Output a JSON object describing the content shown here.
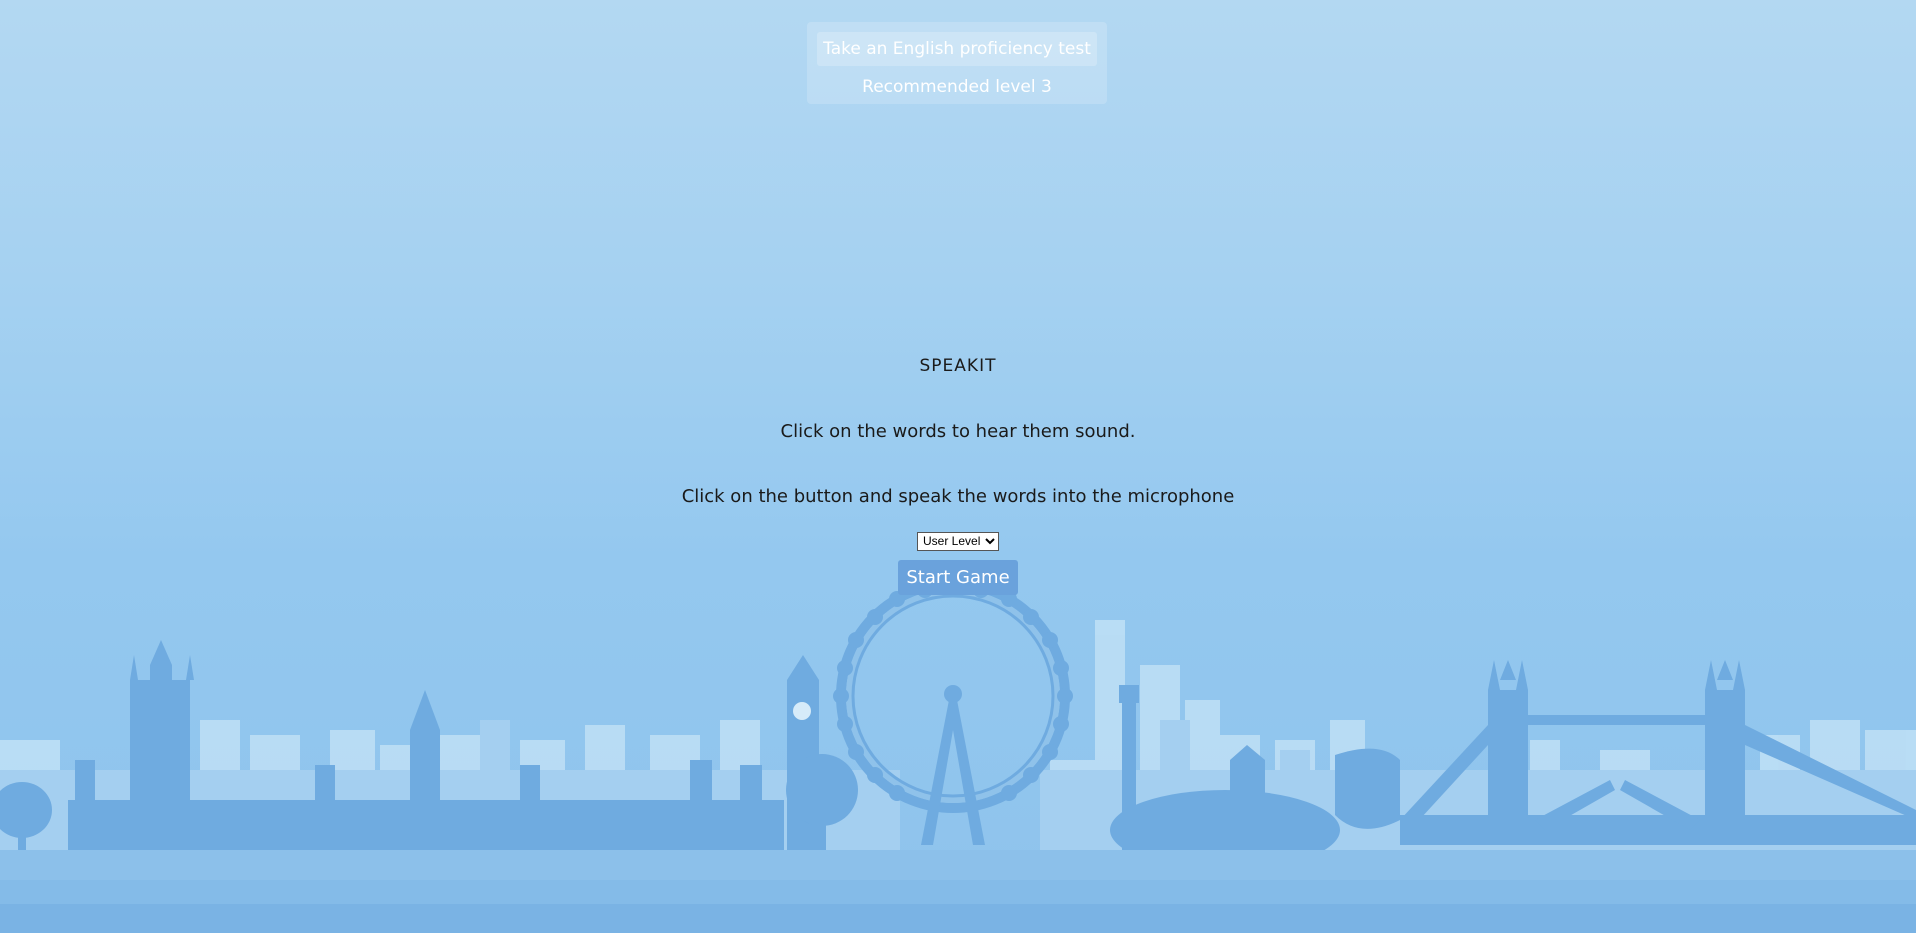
{
  "proficiency": {
    "link_label": "Take an English proficiency test",
    "recommended": "Recommended level 3"
  },
  "main": {
    "title": "SPEAKIT",
    "instruction_1": "Click on the words to hear them sound.",
    "instruction_2": "Click on the button and speak the words into the microphone",
    "level_select": {
      "selected": "User Level"
    },
    "start_label": "Start Game"
  },
  "colors": {
    "sky_top": "#b3d8f2",
    "sky_bottom": "#8ec3ec",
    "skyline_far": "#bfe0f6",
    "skyline_near": "#6fabe0",
    "ground": "#7ab3e4",
    "start_button": "#6aa2dc"
  }
}
